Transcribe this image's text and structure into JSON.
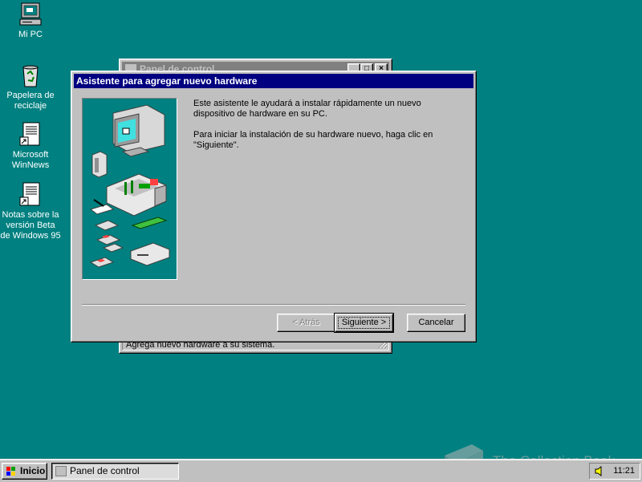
{
  "desktop": {
    "icons": [
      {
        "label": "Mi PC"
      },
      {
        "label": "Papelera de reciclaje"
      },
      {
        "label": "Microsoft WinNews"
      },
      {
        "label": "Notas sobre la versión Beta de Windows 95"
      }
    ]
  },
  "background_window": {
    "title": "Panel de control",
    "status_text": "Agrega nuevo hardware a su sistema."
  },
  "wizard": {
    "title": "Asistente para agregar nuevo hardware",
    "paragraph_1": "Este asistente le ayudará a instalar rápidamente un nuevo dispositivo de hardware en su PC.",
    "paragraph_2": "Para iniciar la instalación de su hardware nuevo, haga clic en \"Siguiente\".",
    "buttons": {
      "back": "< Atrás",
      "next": "Siguiente >",
      "cancel": "Cancelar"
    },
    "art_background": "#008080"
  },
  "taskbar": {
    "start_label": "Inicio",
    "task_items": [
      {
        "label": "Panel de control"
      }
    ],
    "clock": "11:21"
  },
  "watermark": {
    "text": "The Collection Book"
  },
  "colors": {
    "desktop": "#008080",
    "title_active": "#000080",
    "title_inactive": "#808080",
    "face": "#c0c0c0"
  }
}
